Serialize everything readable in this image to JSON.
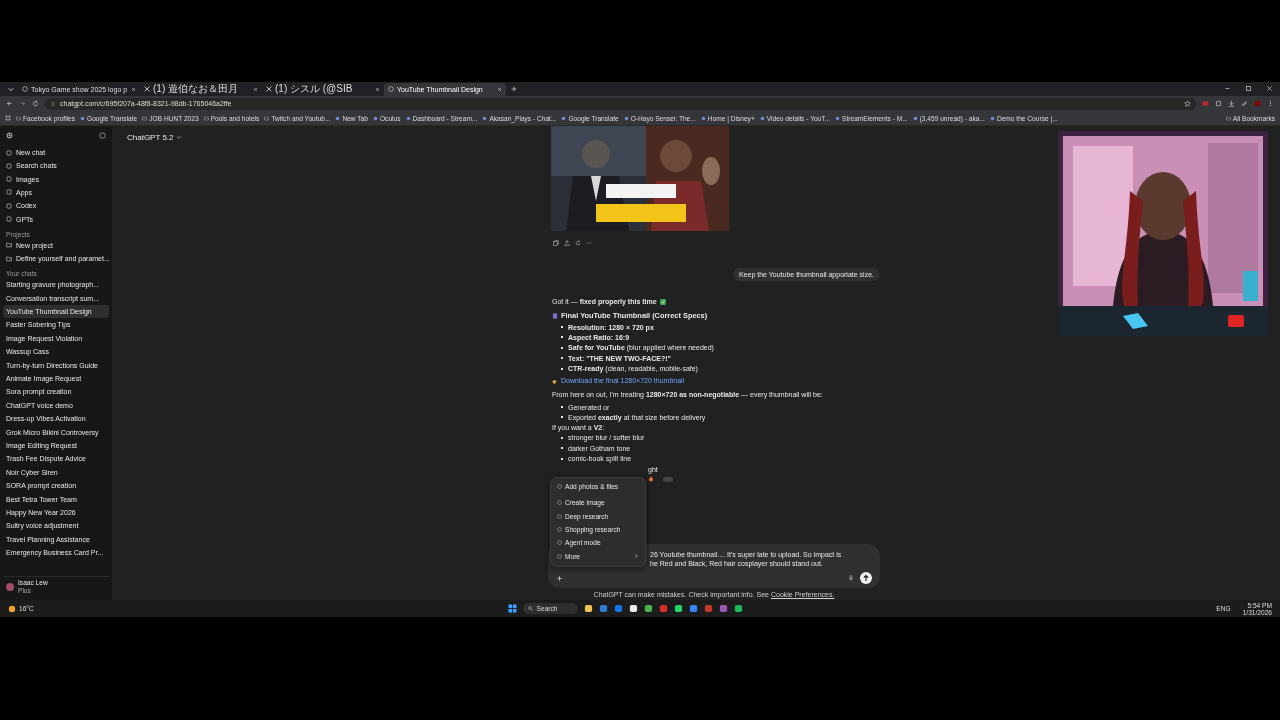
{
  "browser": {
    "tabs": [
      {
        "title": "Tokyo Game show 2025 logo p",
        "selected": false
      },
      {
        "title": "(1) 遊伯なお＆田月",
        "selected": false
      },
      {
        "title": "(1) シスル (@SIB",
        "selected": false
      },
      {
        "title": "YouTube Thumbnail Design",
        "selected": true
      }
    ],
    "url": "chatgpt.com/c/695f207a-48f8-8321-98db-1765046a2ffe",
    "bookmarks": [
      {
        "label": "Facebook profiles",
        "kind": "folder"
      },
      {
        "label": "Google Translate",
        "kind": "site"
      },
      {
        "label": "JOB HUNT 2023",
        "kind": "folder"
      },
      {
        "label": "Pools and hotels",
        "kind": "folder"
      },
      {
        "label": "Twitch and Youtub...",
        "kind": "folder"
      },
      {
        "label": "New Tab",
        "kind": "site"
      },
      {
        "label": "Oculus",
        "kind": "site"
      },
      {
        "label": "Dashboard - Stream...",
        "kind": "site"
      },
      {
        "label": "Akasan_Plays - Chat...",
        "kind": "site"
      },
      {
        "label": "Google Translate",
        "kind": "site"
      },
      {
        "label": "O-Hayo Sensei: The...",
        "kind": "site"
      },
      {
        "label": "Home | Disney+",
        "kind": "site"
      },
      {
        "label": "Video details - YouT...",
        "kind": "site"
      },
      {
        "label": "StreamElements - M...",
        "kind": "site"
      },
      {
        "label": "(3,459 unread) - aka...",
        "kind": "site"
      },
      {
        "label": "Demo the Course |...",
        "kind": "site"
      }
    ],
    "all_bookmarks": "All Bookmarks"
  },
  "sidebar": {
    "nav": [
      "New chat",
      "Search chats",
      "Images",
      "Apps",
      "Codex",
      "GPTs"
    ],
    "projects_heading": "Projects",
    "projects": [
      "New project",
      "Define yourself and paramet..."
    ],
    "chats_heading": "Your chats",
    "chats": [
      {
        "title": "Starting gravure photograph...",
        "selected": false
      },
      {
        "title": "Conversation transcript sum...",
        "selected": false
      },
      {
        "title": "YouTube Thumbnail Design",
        "selected": true
      },
      {
        "title": "Faster Sobering Tips",
        "selected": false
      },
      {
        "title": "Image Request Violation",
        "selected": false
      },
      {
        "title": "Wassup Cass",
        "selected": false
      },
      {
        "title": "Turn-by-turn Directions Guide",
        "selected": false
      },
      {
        "title": "Animate Image Request",
        "selected": false
      },
      {
        "title": "Sora prompt creation",
        "selected": false
      },
      {
        "title": "ChatGPT voice demo",
        "selected": false
      },
      {
        "title": "Dress-up Vibes Activation",
        "selected": false
      },
      {
        "title": "Grok Micro Bikini Controversy",
        "selected": false
      },
      {
        "title": "Image Editing Request",
        "selected": false
      },
      {
        "title": "Trash Fee Dispute Advice",
        "selected": false
      },
      {
        "title": "Noir Cyber Siren",
        "selected": false
      },
      {
        "title": "SORA prompt creation",
        "selected": false
      },
      {
        "title": "Best Tetra Tower Team",
        "selected": false
      },
      {
        "title": "Happy New Year 2026",
        "selected": false
      },
      {
        "title": "Sultry voice adjustment",
        "selected": false
      },
      {
        "title": "Travel Planning Assistance",
        "selected": false
      },
      {
        "title": "Emergency Business Card Pr...",
        "selected": false
      }
    ],
    "user": {
      "name": "Isaac Lew",
      "plan": "Plus"
    }
  },
  "chat": {
    "model": "ChatGPT 5.2",
    "user_message": "Keep the Youtube thumbnail apporiate size.",
    "reply": {
      "intro": "Got it — **fixed properly this time**",
      "heading": "Final YouTube Thumbnail (Correct Specs)",
      "specs": [
        "**Resolution: 1280 × 720 px**",
        "**Aspect Ratio: 16:9**",
        "**Safe for YouTube** (blur applied where needed)",
        "**Text: \"THE NEW TWO-FACE?!\"**",
        "**CTR-ready** (clean, readable, mobile-safe)"
      ],
      "download_link": "Download the final 1280×720 thumbnail",
      "policy": "From here on out, I'm treating **1280×720 as non-negotiable** — every thumbnail will be:",
      "policy_items": [
        "Generated or",
        "Exported **exactly** at that size before delivery"
      ],
      "v2_intro": "If you want a **V2**:",
      "v2_items": [
        "stronger blur / softer blur",
        "darker Gotham tone",
        "comic-book split line"
      ],
      "partly_hidden_line": "ght"
    },
    "menu": [
      {
        "label": "Add photos & files",
        "submenu": false
      },
      {
        "label": "Create image",
        "submenu": false
      },
      {
        "label": "Deep research",
        "submenu": false
      },
      {
        "label": "Shopping research",
        "submenu": false
      },
      {
        "label": "Agent mode",
        "submenu": false
      },
      {
        "label": "More",
        "submenu": true
      }
    ],
    "composer_lines": [
      "26 Youtube thumbnail.... It's super late to upload. So impact is",
      "he Red and Black, Red hair cosplayer should stand out."
    ],
    "disclaimer": "ChatGPT can make mistakes. Check important info. See",
    "cookie_link": "Cookie Preferences."
  },
  "taskbar": {
    "weather": "16°C",
    "search": "Search",
    "language": "ENG",
    "time": "5:54 PM",
    "date": "1/31/2026"
  }
}
